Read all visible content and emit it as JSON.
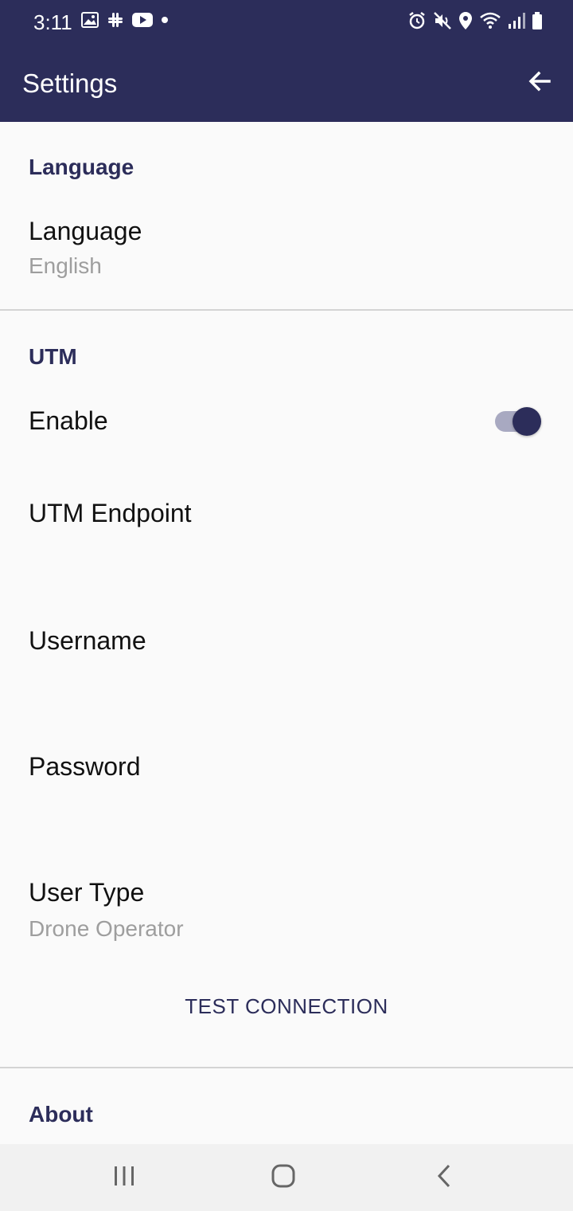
{
  "status_bar": {
    "time": "3:11",
    "left_icons": [
      "gallery-icon",
      "slack-icon",
      "youtube-icon",
      "dot-icon"
    ],
    "right_icons": [
      "alarm-icon",
      "mute-icon",
      "location-icon",
      "wifi-icon",
      "signal-icon",
      "battery-icon"
    ]
  },
  "app_bar": {
    "title": "Settings",
    "back_icon": "arrow-back-icon"
  },
  "sections": {
    "language": {
      "header": "Language",
      "items": [
        {
          "title": "Language",
          "summary": "English"
        }
      ]
    },
    "utm": {
      "header": "UTM",
      "enable": {
        "title": "Enable",
        "checked": true
      },
      "endpoint": {
        "title": "UTM Endpoint"
      },
      "username": {
        "title": "Username"
      },
      "password": {
        "title": "Password"
      },
      "user_type": {
        "title": "User Type",
        "summary": "Drone Operator"
      },
      "test_button": "TEST CONNECTION"
    },
    "about": {
      "header": "About"
    }
  },
  "nav_bar": {
    "icons": [
      "recent-apps-icon",
      "home-icon",
      "back-nav-icon"
    ]
  },
  "colors": {
    "primary": "#2c2d5a",
    "background": "#fafafa",
    "summary_text": "#9e9e9e",
    "divider": "#d4d4d4"
  }
}
